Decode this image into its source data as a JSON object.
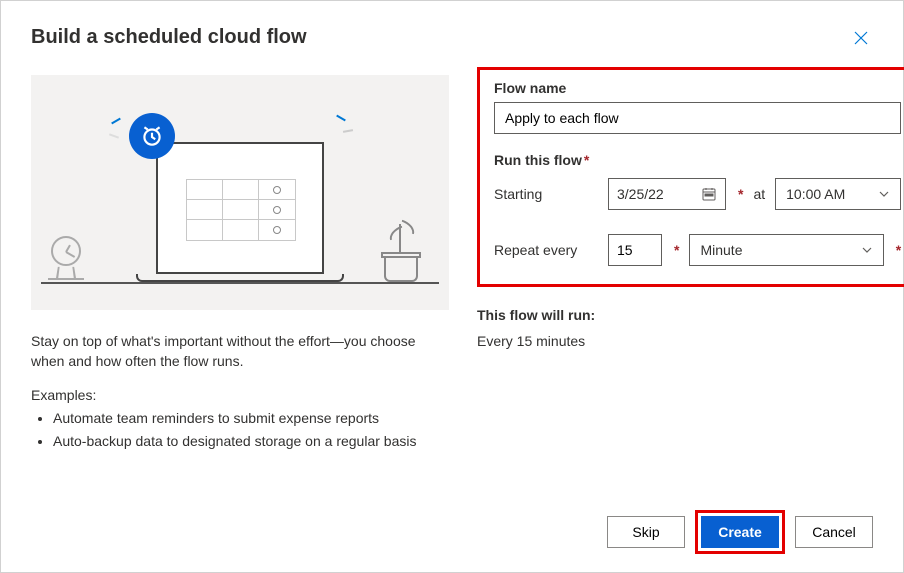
{
  "dialog": {
    "title": "Build a scheduled cloud flow"
  },
  "left_pane": {
    "description": "Stay on top of what's important without the effort—you choose when and how often the flow runs.",
    "examples_heading": "Examples:",
    "examples": [
      "Automate team reminders to submit expense reports",
      "Auto-backup data to designated storage on a regular basis"
    ]
  },
  "form": {
    "flow_name_label": "Flow name",
    "flow_name_value": "Apply to each flow",
    "run_section_label": "Run this flow",
    "starting_label": "Starting",
    "starting_date": "3/25/22",
    "at_label": "at",
    "starting_time": "10:00 AM",
    "repeat_label": "Repeat every",
    "repeat_value": "15",
    "repeat_unit": "Minute"
  },
  "summary": {
    "label": "This flow will run:",
    "text": "Every 15 minutes"
  },
  "buttons": {
    "skip": "Skip",
    "create": "Create",
    "cancel": "Cancel"
  }
}
